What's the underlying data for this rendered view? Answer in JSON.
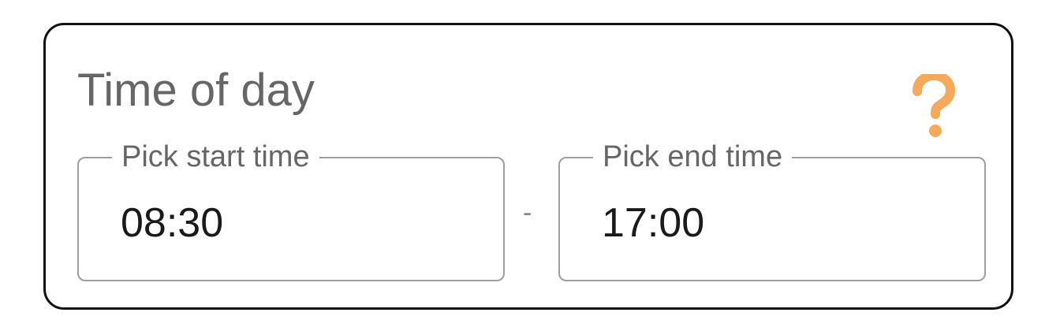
{
  "card": {
    "title": "Time of day",
    "help_icon": "question-mark-icon",
    "help_icon_color": "#f5a95a"
  },
  "start_time": {
    "label": "Pick start time",
    "value": "08:30"
  },
  "end_time": {
    "label": "Pick end time",
    "value": "17:00"
  },
  "range_separator": "-"
}
